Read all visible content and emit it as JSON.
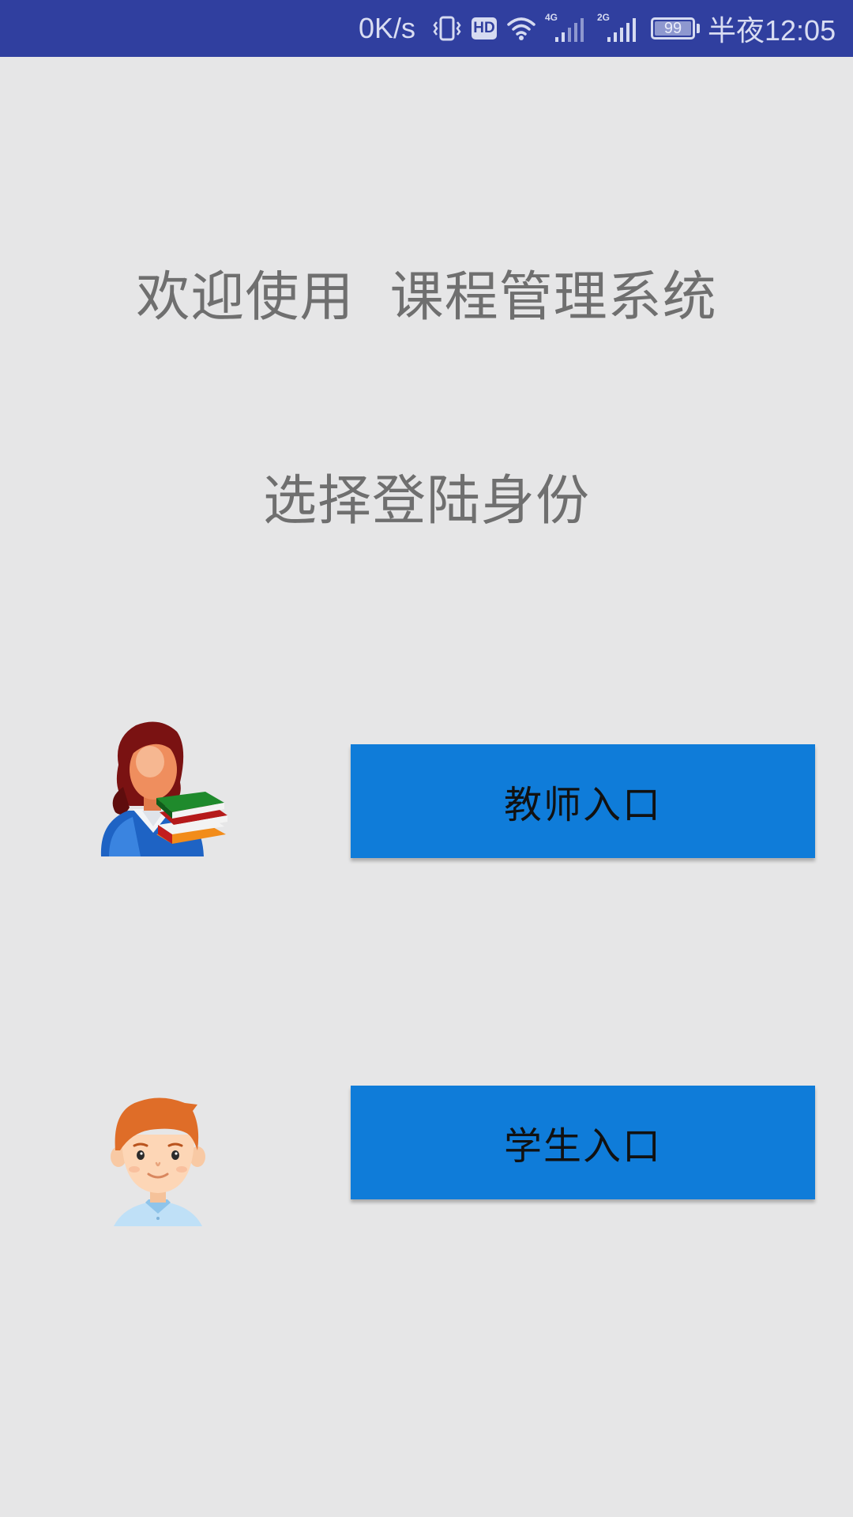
{
  "status_bar": {
    "net_speed": "0K/s",
    "hd_label": "HD",
    "network_1": "4G",
    "network_2": "2G",
    "battery_level": "99",
    "battery_fraction": 0.99,
    "clock": "半夜12:05",
    "icons": [
      "vibrate-icon",
      "hd-icon",
      "wifi-icon",
      "signal-4g-icon",
      "signal-2g-icon",
      "battery-icon"
    ],
    "background_color": "#303f9f"
  },
  "main": {
    "welcome_title": "欢迎使用  课程管理系统",
    "select_role_title": "选择登陆身份",
    "background_color": "#e6e6e7"
  },
  "roles": {
    "teacher": {
      "avatar": "teacher-avatar-icon",
      "button_label": "教师入口"
    },
    "student": {
      "avatar": "student-avatar-icon",
      "button_label": "学生入口"
    },
    "button_color": "#0f7cd9"
  }
}
